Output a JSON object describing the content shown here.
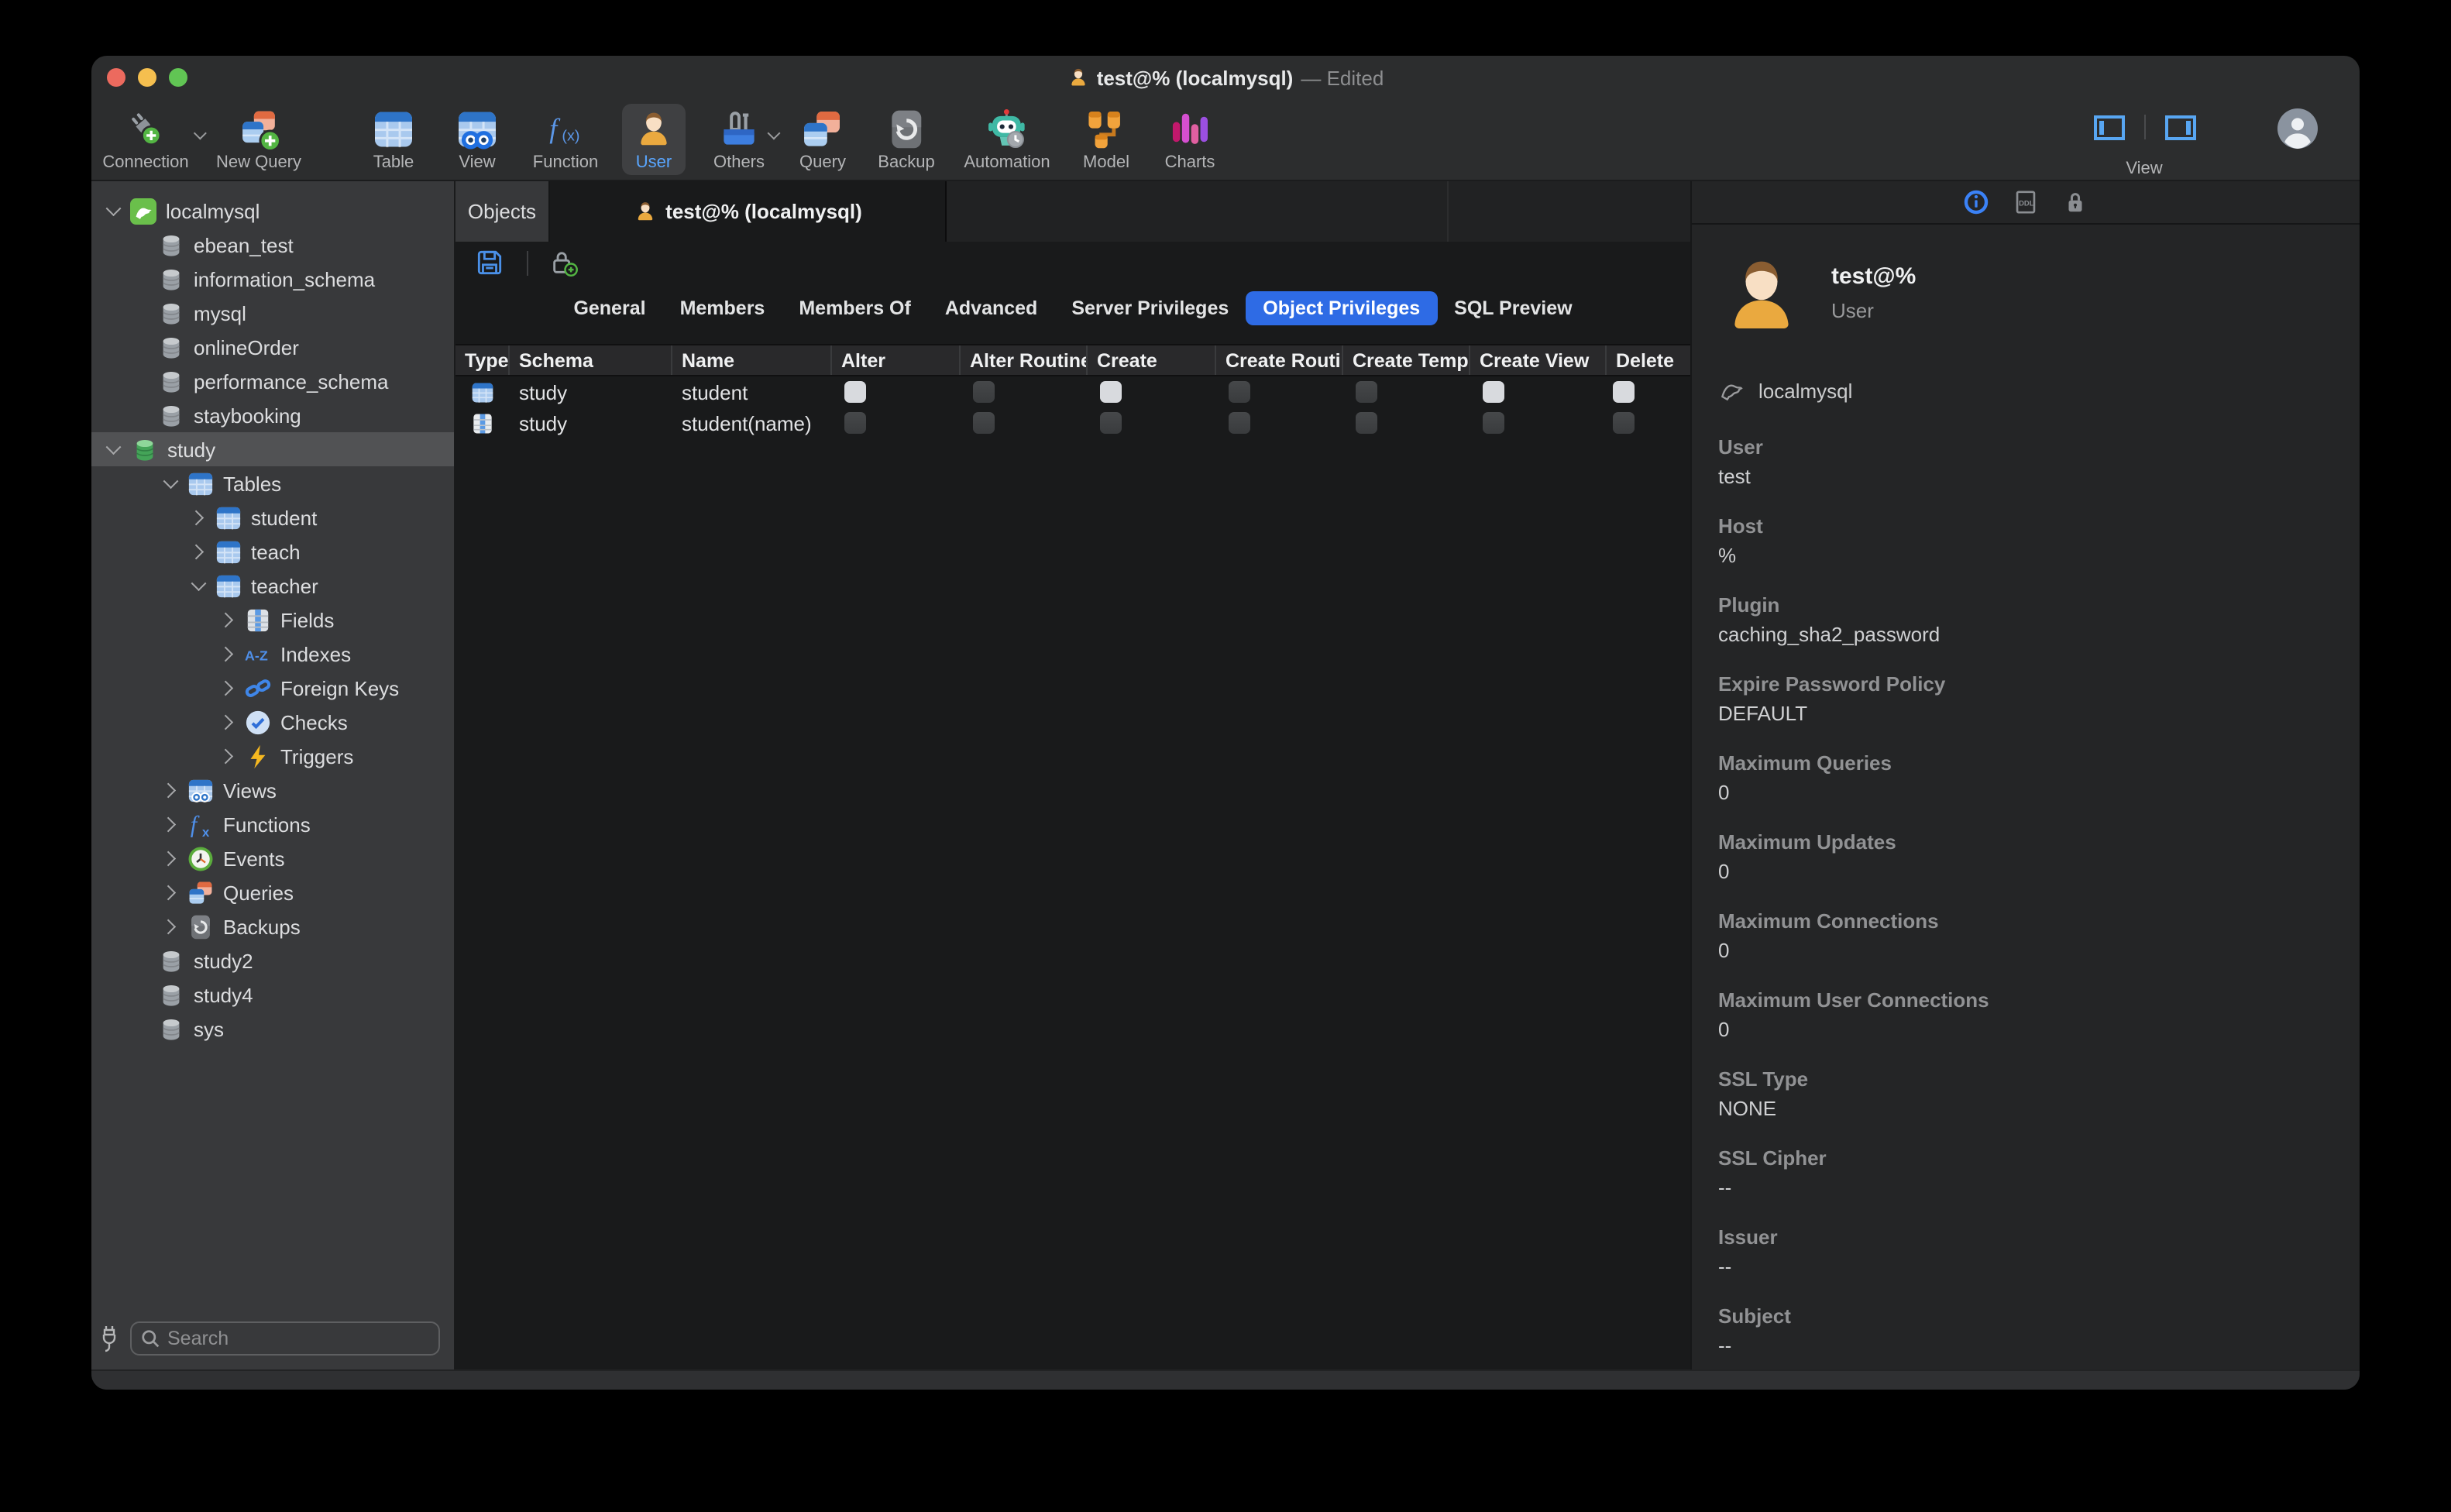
{
  "titlebar": {
    "title": "test@% (localmysql)",
    "edited": "— Edited"
  },
  "toolbar": {
    "items": [
      {
        "label": "Connection"
      },
      {
        "label": "New Query"
      },
      {
        "label": "Table"
      },
      {
        "label": "View"
      },
      {
        "label": "Function"
      },
      {
        "label": "User"
      },
      {
        "label": "Others"
      },
      {
        "label": "Query"
      },
      {
        "label": "Backup"
      },
      {
        "label": "Automation"
      },
      {
        "label": "Model"
      },
      {
        "label": "Charts"
      }
    ],
    "selected_item": "User",
    "view_label": "View"
  },
  "sidebar": {
    "items": [
      {
        "label": "localmysql"
      },
      {
        "label": "ebean_test"
      },
      {
        "label": "information_schema"
      },
      {
        "label": "mysql"
      },
      {
        "label": "onlineOrder"
      },
      {
        "label": "performance_schema"
      },
      {
        "label": "staybooking"
      },
      {
        "label": "study"
      },
      {
        "label": "Tables"
      },
      {
        "label": "student"
      },
      {
        "label": "teach"
      },
      {
        "label": "teacher"
      },
      {
        "label": "Fields"
      },
      {
        "label": "Indexes"
      },
      {
        "label": "Foreign Keys"
      },
      {
        "label": "Checks"
      },
      {
        "label": "Triggers"
      },
      {
        "label": "Views"
      },
      {
        "label": "Functions"
      },
      {
        "label": "Events"
      },
      {
        "label": "Queries"
      },
      {
        "label": "Backups"
      },
      {
        "label": "study2"
      },
      {
        "label": "study4"
      },
      {
        "label": "sys"
      }
    ],
    "selected_item": "study",
    "search_placeholder": "Search"
  },
  "tabs": {
    "objects": "Objects",
    "active": "test@% (localmysql)"
  },
  "priv_tabs": {
    "items": [
      {
        "label": "General"
      },
      {
        "label": "Members"
      },
      {
        "label": "Members Of"
      },
      {
        "label": "Advanced"
      },
      {
        "label": "Server Privileges"
      },
      {
        "label": "Object Privileges"
      },
      {
        "label": "SQL Preview"
      }
    ],
    "selected": "Object Privileges"
  },
  "grid": {
    "columns": [
      {
        "label": "Type"
      },
      {
        "label": "Schema"
      },
      {
        "label": "Name"
      },
      {
        "label": "Alter"
      },
      {
        "label": "Alter Routine"
      },
      {
        "label": "Create"
      },
      {
        "label": "Create Routi…"
      },
      {
        "label": "Create Temp…"
      },
      {
        "label": "Create View"
      },
      {
        "label": "Delete"
      }
    ],
    "rows": [
      {
        "type_icon": "table-icon",
        "schema": "study",
        "name": "student",
        "privs": [
          "on",
          "off",
          "on",
          "off",
          "off",
          "on",
          "on"
        ]
      },
      {
        "type_icon": "column-icon",
        "schema": "study",
        "name": "student(name)",
        "privs": [
          "off",
          "off",
          "off",
          "off",
          "off",
          "off",
          "off"
        ]
      }
    ]
  },
  "info": {
    "title": "test@%",
    "subtitle": "User",
    "connection": "localmysql",
    "fields": [
      {
        "label": "User",
        "value": "test"
      },
      {
        "label": "Host",
        "value": "%"
      },
      {
        "label": "Plugin",
        "value": "caching_sha2_password"
      },
      {
        "label": "Expire Password Policy",
        "value": "DEFAULT"
      },
      {
        "label": "Maximum Queries",
        "value": "0"
      },
      {
        "label": "Maximum Updates",
        "value": "0"
      },
      {
        "label": "Maximum Connections",
        "value": "0"
      },
      {
        "label": "Maximum User Connections",
        "value": "0"
      },
      {
        "label": "SSL Type",
        "value": "NONE"
      },
      {
        "label": "SSL Cipher",
        "value": "--"
      },
      {
        "label": "Issuer",
        "value": "--"
      },
      {
        "label": "Subject",
        "value": "--"
      }
    ]
  },
  "icons": {
    "connection-icon": "plug + green plus",
    "new-query-icon": "stacked tables + green plus",
    "table-icon": "blue grid table",
    "view-icon": "table + binoculars",
    "function-icon": "f(x)",
    "user-icon": "person bust",
    "others-icon": "toolbox",
    "query-icon": "stacked tables",
    "backup-icon": "circular arrow",
    "automation-icon": "robot",
    "model-icon": "org-chart boxes",
    "charts-icon": "purple bars",
    "database-icon": "gray cylinder",
    "mysql-connection-icon": "green dolphin square",
    "fields-icon": "column table",
    "indexes-icon": "A-Z",
    "foreign-keys-icon": "chain links",
    "checks-icon": "check circle",
    "triggers-icon": "lightning bolt",
    "events-icon": "clock",
    "save-icon": "blue floppy disk",
    "add-privilege-icon": "lock + green plus",
    "info-icon": "blue circled i",
    "ddl-icon": "DDL document",
    "lock-icon": "padlock",
    "sidebar-toggle-left-icon": "panel outline, left bar",
    "sidebar-toggle-right-icon": "panel outline, right bar",
    "search-icon": "magnifier",
    "window-buttons": "red yellow green"
  },
  "colors": {
    "accent_blue": "#2e6be5",
    "toolbar_selected_text": "#59a6ff",
    "checkbox_on": "#d8dade",
    "checkbox_off": "#3c3e40",
    "sidebar_bg": "#38393b",
    "main_bg": "#191a1b",
    "panel_bg": "#242526",
    "window_bg": "#2c2d2e"
  }
}
